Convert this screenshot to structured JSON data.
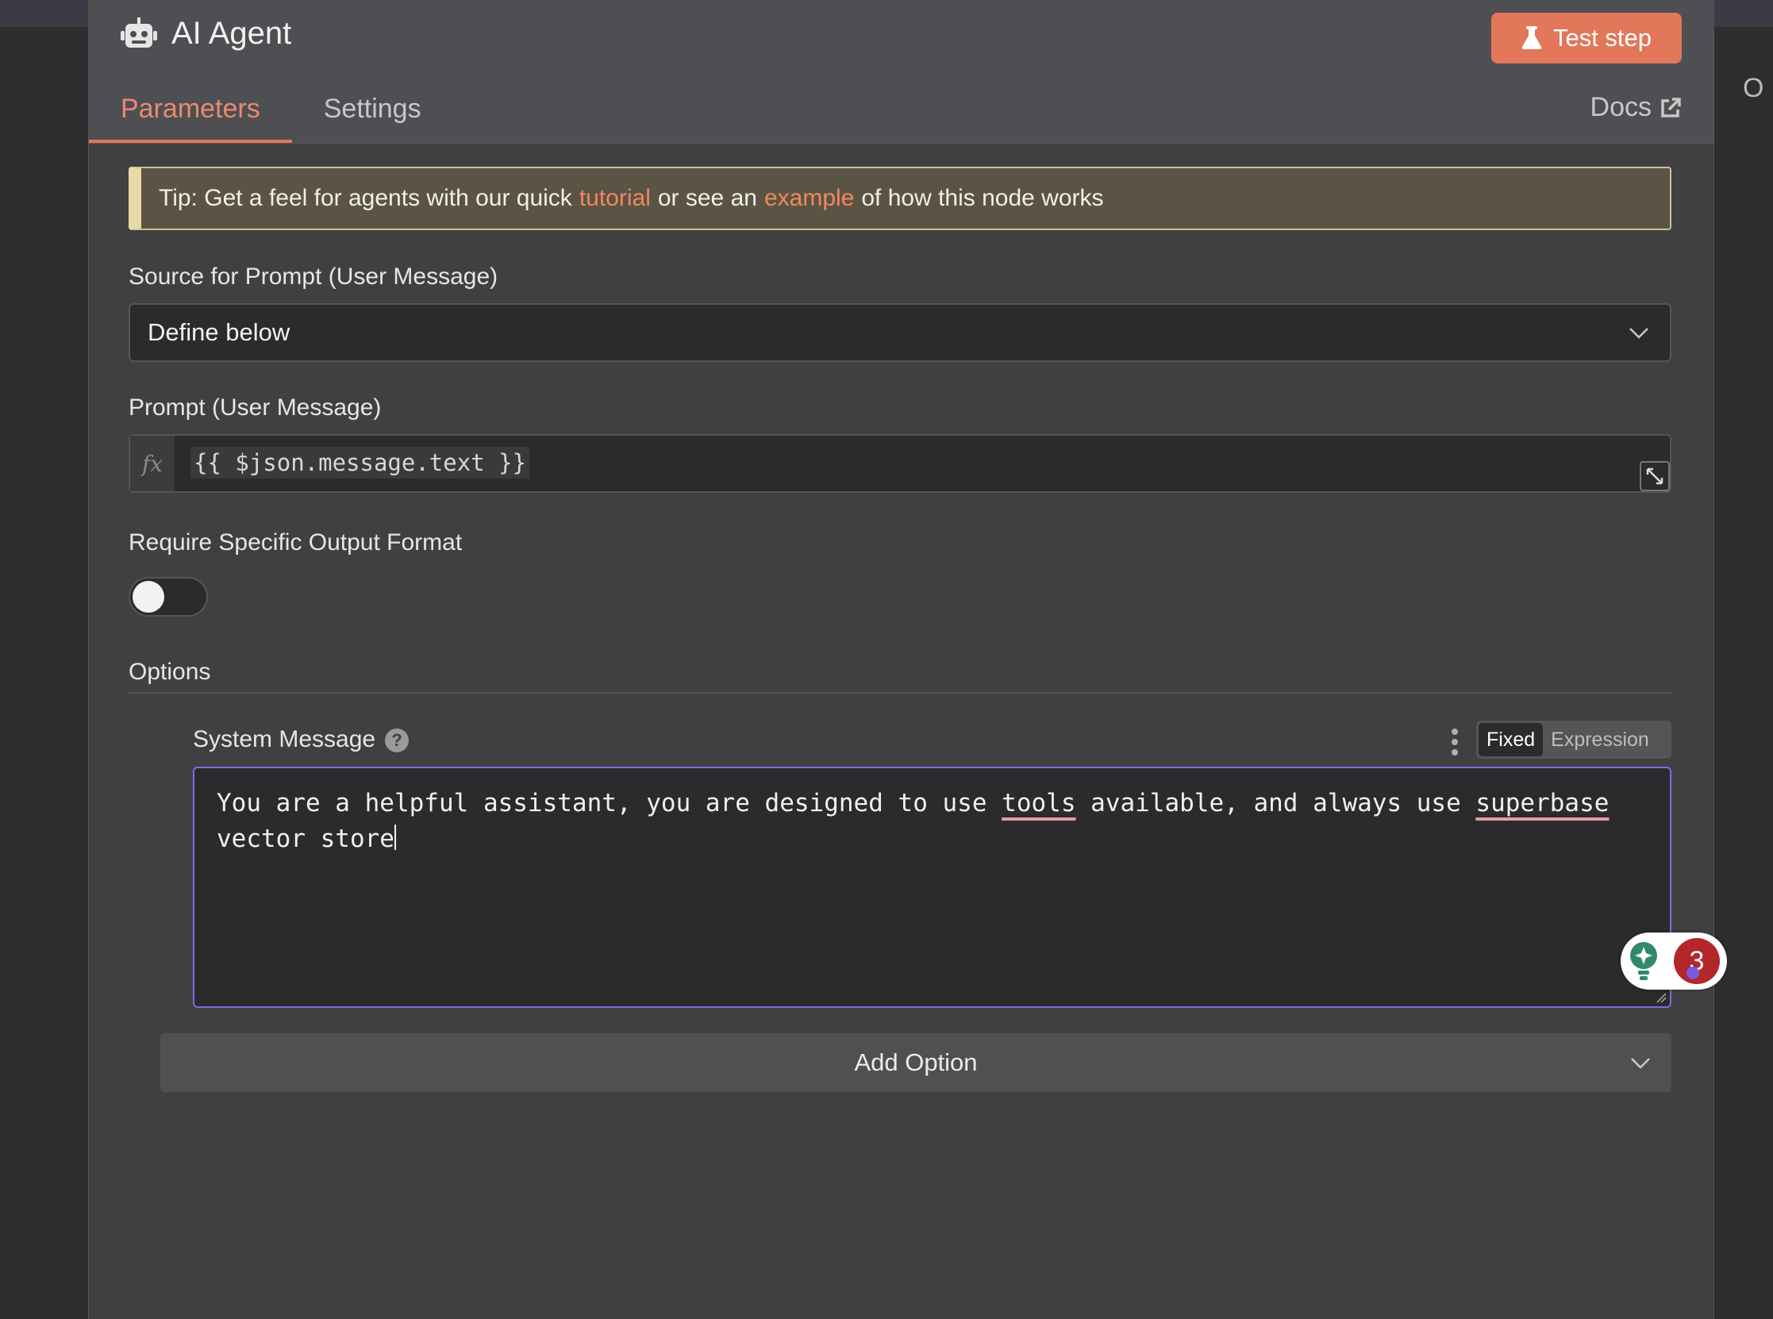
{
  "header": {
    "title": "AI Agent",
    "test_button": "Test step",
    "tabs": [
      "Parameters",
      "Settings"
    ],
    "docs_label": "Docs"
  },
  "tip": {
    "prefix": "Tip: Get a feel for agents with our quick",
    "link1": "tutorial",
    "middle": "or see an",
    "link2": "example",
    "suffix": "of how this node works"
  },
  "source_field": {
    "label": "Source for Prompt (User Message)",
    "value": "Define below"
  },
  "prompt_field": {
    "label": "Prompt (User Message)",
    "fx": "fx",
    "value": "{{ $json.message.text }}"
  },
  "output_format": {
    "label": "Require Specific Output Format",
    "enabled": false
  },
  "options": {
    "heading": "Options",
    "system_message": {
      "label": "System Message",
      "mode_fixed": "Fixed",
      "mode_expression": "Expression",
      "active_mode": "Fixed",
      "text_part1": "You are a helpful assistant, you are designed to use ",
      "word1": "tools",
      "text_part2": " available, and always use ",
      "word2": "superbase",
      "text_part3": "vector store"
    },
    "add_option": "Add Option"
  },
  "grammar_widget": {
    "count": "3"
  },
  "right_edge_letter": "O",
  "colors": {
    "accent": "#e2775a",
    "focus_border": "#7b6ee0",
    "tip_bg": "#5b5444"
  }
}
